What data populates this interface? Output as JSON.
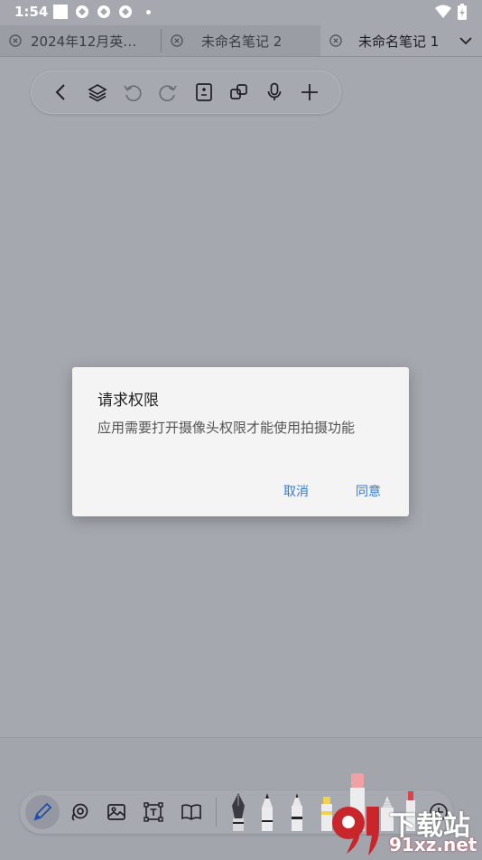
{
  "status_bar": {
    "time": "1:54"
  },
  "tabs": [
    {
      "label": "2024年12月英…",
      "active": false
    },
    {
      "label": "未命名笔记 2",
      "active": false
    },
    {
      "label": "未命名笔记 1",
      "active": true
    }
  ],
  "toolbar": {
    "icons": [
      "back-icon",
      "layers-icon",
      "undo-icon",
      "redo-icon",
      "page-icon",
      "copy-icon",
      "microphone-icon",
      "add-icon"
    ]
  },
  "dialog": {
    "title": "请求权限",
    "message": "应用需要打开摄像头权限才能使用拍摄功能",
    "cancel_label": "取消",
    "ok_label": "同意"
  },
  "bottom_toolbar": {
    "icons": [
      "pen-icon",
      "lasso-icon",
      "image-icon",
      "text-box-icon",
      "book-icon",
      "fountain-pen-icon",
      "pencil-icon",
      "marker-icon",
      "highlighter-icon",
      "eraser-icon",
      "brush-icon",
      "add-tool-icon"
    ]
  },
  "watermark": {
    "site": "91xz.net",
    "cn": "下载站"
  },
  "colors": {
    "accent": "#2f7ce0",
    "overlay": "#a6a8b0",
    "dialog_bg": "#f4f4f5"
  }
}
